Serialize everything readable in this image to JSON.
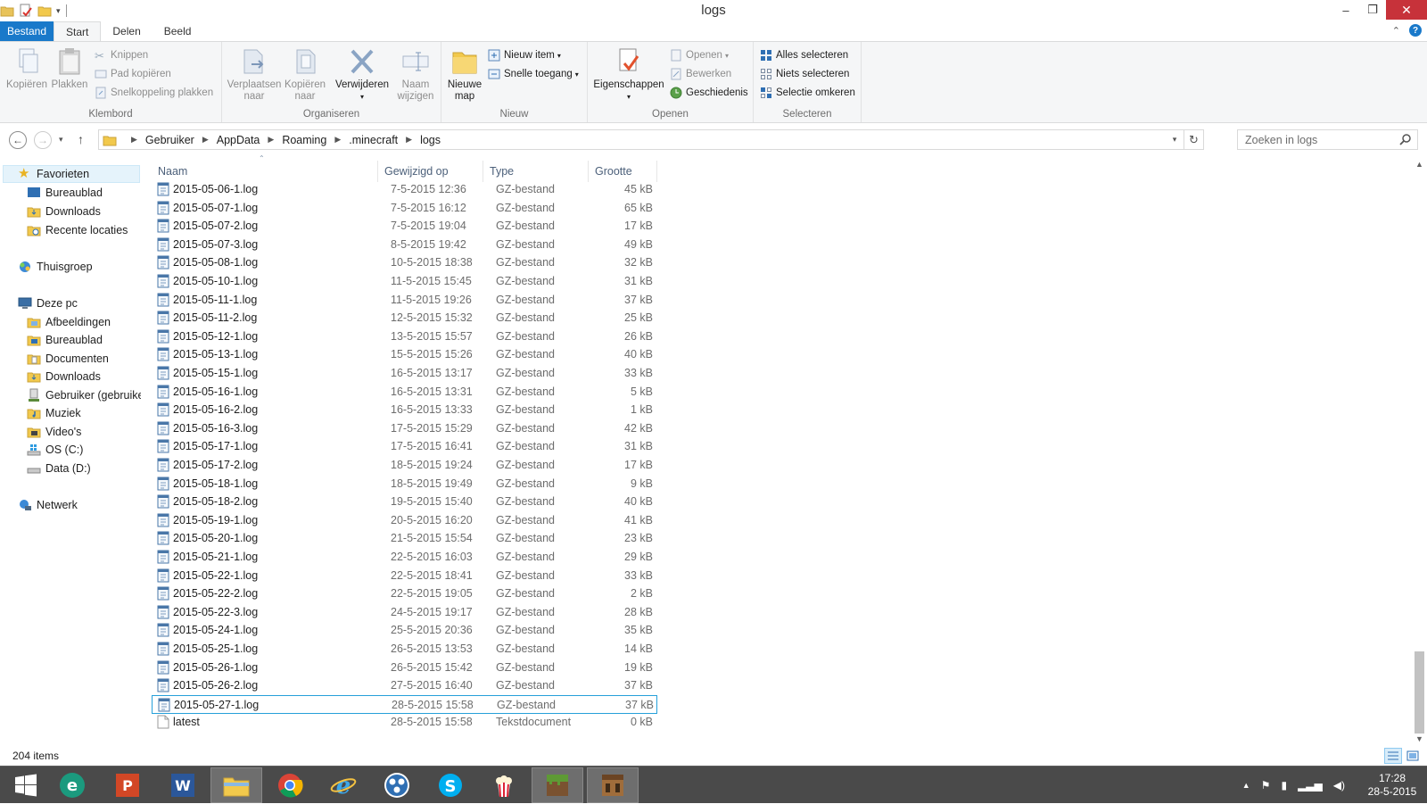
{
  "window": {
    "title": "logs",
    "minimize": "–",
    "restore": "❐",
    "close": "✕"
  },
  "ribbon_tabs": [
    "Bestand",
    "Start",
    "Delen",
    "Beeld"
  ],
  "ribbon": {
    "klembord": {
      "title": "Klembord",
      "kopieren": "Kopiëren",
      "plakken": "Plakken",
      "knippen": "Knippen",
      "pad_kopieren": "Pad kopiëren",
      "snelkoppeling_plakken": "Snelkoppeling plakken"
    },
    "organiseren": {
      "title": "Organiseren",
      "verplaatsen_1": "Verplaatsen",
      "verplaatsen_2": "naar",
      "kopieren_1": "Kopiëren",
      "kopieren_2": "naar",
      "verwijderen": "Verwijderen",
      "naam_1": "Naam",
      "naam_2": "wijzigen"
    },
    "nieuw": {
      "title": "Nieuw",
      "nieuwe_1": "Nieuwe",
      "nieuwe_2": "map",
      "nieuw_item": "Nieuw item",
      "snelle_toegang": "Snelle toegang"
    },
    "openen": {
      "title": "Openen",
      "eigenschappen": "Eigenschappen",
      "openen": "Openen",
      "bewerken": "Bewerken",
      "geschiedenis": "Geschiedenis"
    },
    "selecteren": {
      "title": "Selecteren",
      "alles": "Alles selecteren",
      "niets": "Niets selecteren",
      "omkeren": "Selectie omkeren"
    }
  },
  "address": {
    "crumbs": [
      "Gebruiker",
      "AppData",
      "Roaming",
      ".minecraft",
      "logs"
    ],
    "search_placeholder": "Zoeken in logs"
  },
  "navpane": {
    "favorites": "Favorieten",
    "fav_items": [
      "Bureaublad",
      "Downloads",
      "Recente locaties"
    ],
    "homegroup": "Thuisgroep",
    "thispc": "Deze pc",
    "pc_items": [
      "Afbeeldingen",
      "Bureaublad",
      "Documenten",
      "Downloads",
      "Gebruiker (gebruiker",
      "Muziek",
      "Video's",
      "OS (C:)",
      "Data (D:)"
    ],
    "network": "Netwerk"
  },
  "columns": {
    "name": "Naam",
    "date": "Gewijzigd op",
    "type": "Type",
    "size": "Grootte"
  },
  "files": [
    {
      "name": "2015-05-06-1.log",
      "date": "7-5-2015 12:36",
      "type": "GZ-bestand",
      "size": "45 kB"
    },
    {
      "name": "2015-05-07-1.log",
      "date": "7-5-2015 16:12",
      "type": "GZ-bestand",
      "size": "65 kB"
    },
    {
      "name": "2015-05-07-2.log",
      "date": "7-5-2015 19:04",
      "type": "GZ-bestand",
      "size": "17 kB"
    },
    {
      "name": "2015-05-07-3.log",
      "date": "8-5-2015 19:42",
      "type": "GZ-bestand",
      "size": "49 kB"
    },
    {
      "name": "2015-05-08-1.log",
      "date": "10-5-2015 18:38",
      "type": "GZ-bestand",
      "size": "32 kB"
    },
    {
      "name": "2015-05-10-1.log",
      "date": "11-5-2015 15:45",
      "type": "GZ-bestand",
      "size": "31 kB"
    },
    {
      "name": "2015-05-11-1.log",
      "date": "11-5-2015 19:26",
      "type": "GZ-bestand",
      "size": "37 kB"
    },
    {
      "name": "2015-05-11-2.log",
      "date": "12-5-2015 15:32",
      "type": "GZ-bestand",
      "size": "25 kB"
    },
    {
      "name": "2015-05-12-1.log",
      "date": "13-5-2015 15:57",
      "type": "GZ-bestand",
      "size": "26 kB"
    },
    {
      "name": "2015-05-13-1.log",
      "date": "15-5-2015 15:26",
      "type": "GZ-bestand",
      "size": "40 kB"
    },
    {
      "name": "2015-05-15-1.log",
      "date": "16-5-2015 13:17",
      "type": "GZ-bestand",
      "size": "33 kB"
    },
    {
      "name": "2015-05-16-1.log",
      "date": "16-5-2015 13:31",
      "type": "GZ-bestand",
      "size": "5 kB"
    },
    {
      "name": "2015-05-16-2.log",
      "date": "16-5-2015 13:33",
      "type": "GZ-bestand",
      "size": "1 kB"
    },
    {
      "name": "2015-05-16-3.log",
      "date": "17-5-2015 15:29",
      "type": "GZ-bestand",
      "size": "42 kB"
    },
    {
      "name": "2015-05-17-1.log",
      "date": "17-5-2015 16:41",
      "type": "GZ-bestand",
      "size": "31 kB"
    },
    {
      "name": "2015-05-17-2.log",
      "date": "18-5-2015 19:24",
      "type": "GZ-bestand",
      "size": "17 kB"
    },
    {
      "name": "2015-05-18-1.log",
      "date": "18-5-2015 19:49",
      "type": "GZ-bestand",
      "size": "9 kB"
    },
    {
      "name": "2015-05-18-2.log",
      "date": "19-5-2015 15:40",
      "type": "GZ-bestand",
      "size": "40 kB"
    },
    {
      "name": "2015-05-19-1.log",
      "date": "20-5-2015 16:20",
      "type": "GZ-bestand",
      "size": "41 kB"
    },
    {
      "name": "2015-05-20-1.log",
      "date": "21-5-2015 15:54",
      "type": "GZ-bestand",
      "size": "23 kB"
    },
    {
      "name": "2015-05-21-1.log",
      "date": "22-5-2015 16:03",
      "type": "GZ-bestand",
      "size": "29 kB"
    },
    {
      "name": "2015-05-22-1.log",
      "date": "22-5-2015 18:41",
      "type": "GZ-bestand",
      "size": "33 kB"
    },
    {
      "name": "2015-05-22-2.log",
      "date": "22-5-2015 19:05",
      "type": "GZ-bestand",
      "size": "2 kB"
    },
    {
      "name": "2015-05-22-3.log",
      "date": "24-5-2015 19:17",
      "type": "GZ-bestand",
      "size": "28 kB"
    },
    {
      "name": "2015-05-24-1.log",
      "date": "25-5-2015 20:36",
      "type": "GZ-bestand",
      "size": "35 kB"
    },
    {
      "name": "2015-05-25-1.log",
      "date": "26-5-2015 13:53",
      "type": "GZ-bestand",
      "size": "14 kB"
    },
    {
      "name": "2015-05-26-1.log",
      "date": "26-5-2015 15:42",
      "type": "GZ-bestand",
      "size": "19 kB"
    },
    {
      "name": "2015-05-26-2.log",
      "date": "27-5-2015 16:40",
      "type": "GZ-bestand",
      "size": "37 kB"
    },
    {
      "name": "2015-05-27-1.log",
      "date": "28-5-2015 15:58",
      "type": "GZ-bestand",
      "size": "37 kB",
      "selected": true
    },
    {
      "name": "latest",
      "date": "28-5-2015 15:58",
      "type": "Tekstdocument",
      "size": "0 kB",
      "kind": "text"
    }
  ],
  "status": {
    "items": "204 items"
  },
  "taskbar": {
    "apps": [
      "windows-start",
      "internet-explorer-metro",
      "powerpoint",
      "word",
      "file-explorer",
      "chrome",
      "internet-explorer",
      "app-blue-circles",
      "skype",
      "popcorn-time",
      "minecraft",
      "crafting-table"
    ],
    "time": "17:28",
    "date": "28-5-2015"
  },
  "colors": {
    "accent": "#1979ca",
    "selection_border": "#26a0da",
    "taskbar": "#4a4a4a",
    "close": "#c7323a"
  }
}
